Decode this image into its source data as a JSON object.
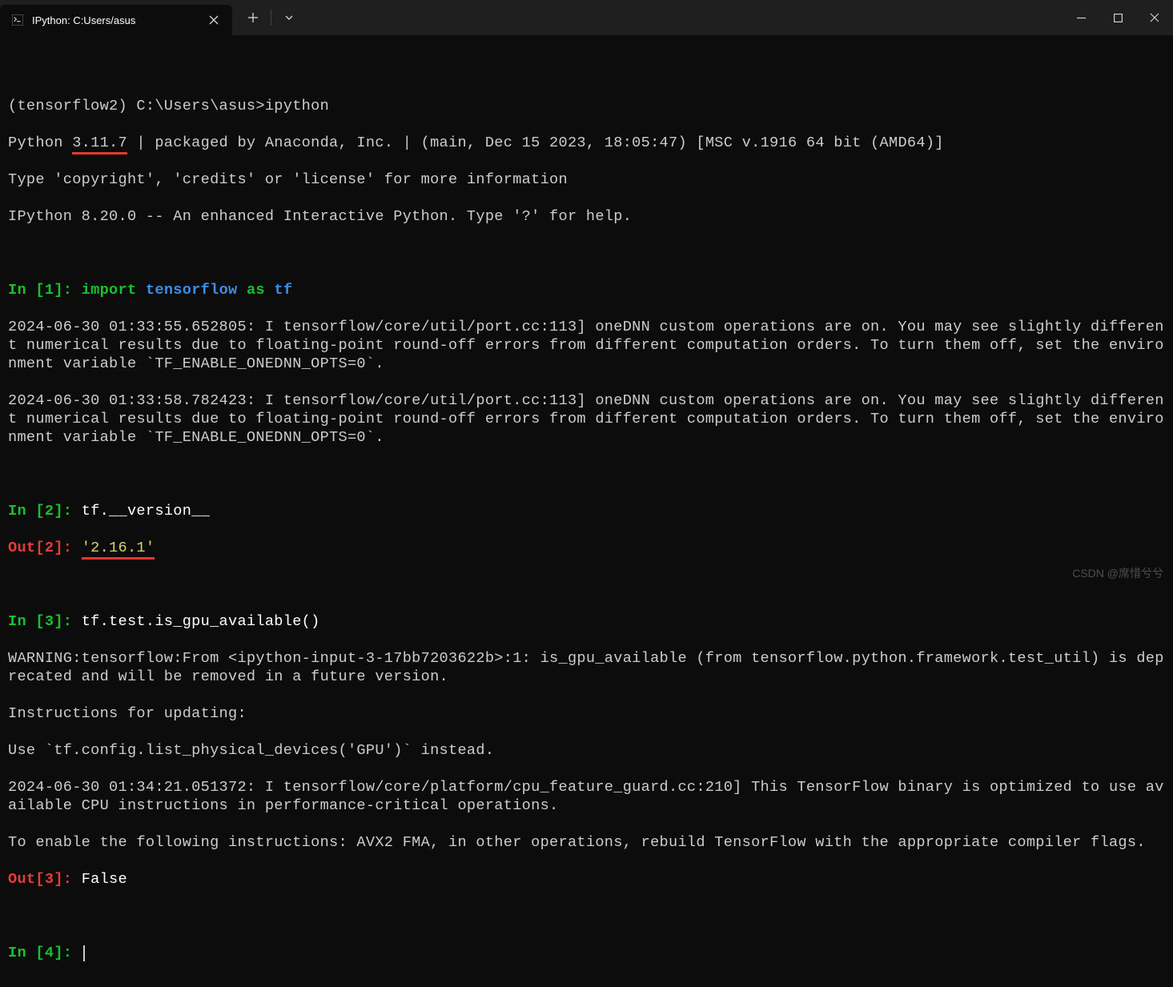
{
  "window": {
    "tab_title": "IPython: C:Users/asus",
    "new_tab_aria": "+",
    "dropdown_aria": "⌵"
  },
  "lines": {
    "l1_prompt": "(tensorflow2) C:\\Users\\asus>ipython",
    "l2_pre": "Python ",
    "l2_ver": "3.11.7",
    "l2_post": " | packaged by Anaconda, Inc. | (main, Dec 15 2023, 18:05:47) [MSC v.1916 64 bit (AMD64)]",
    "l3": "Type 'copyright', 'credits' or 'license' for more information",
    "l4": "IPython 8.20.0 -- An enhanced Interactive Python. Type '?' for help.",
    "in1_label": "In [",
    "in1_n": "1",
    "in1_close": "]: ",
    "import_kw": "import",
    "import_mod": "tensorflow",
    "as_kw": "as",
    "import_alias": "tf",
    "log1": "2024-06-30 01:33:55.652805: I tensorflow/core/util/port.cc:113] oneDNN custom operations are on. You may see slightly different numerical results due to floating-point round-off errors from different computation orders. To turn them off, set the environment variable `TF_ENABLE_ONEDNN_OPTS=0`.",
    "log2": "2024-06-30 01:33:58.782423: I tensorflow/core/util/port.cc:113] oneDNN custom operations are on. You may see slightly different numerical results due to floating-point round-off errors from different computation orders. To turn them off, set the environment variable `TF_ENABLE_ONEDNN_OPTS=0`.",
    "in2_n": "2",
    "in2_code": "tf.__version__",
    "out2_label": "Out[",
    "out2_n": "2",
    "out2_close": "]: ",
    "out2_val": "'2.16.1'",
    "in3_n": "3",
    "in3_code": "tf.test.is_gpu_available()",
    "warn1": "WARNING:tensorflow:From <ipython-input-3-17bb7203622b>:1: is_gpu_available (from tensorflow.python.framework.test_util) is deprecated and will be removed in a future version.",
    "warn2": "Instructions for updating:",
    "warn3": "Use `tf.config.list_physical_devices('GPU')` instead.",
    "log3": "2024-06-30 01:34:21.051372: I tensorflow/core/platform/cpu_feature_guard.cc:210] This TensorFlow binary is optimized to use available CPU instructions in performance-critical operations.",
    "log4": "To enable the following instructions: AVX2 FMA, in other operations, rebuild TensorFlow with the appropriate compiler flags.",
    "out3_n": "3",
    "out3_val": "False",
    "in4_n": "4"
  },
  "watermark": "CSDN @席惜兮兮"
}
